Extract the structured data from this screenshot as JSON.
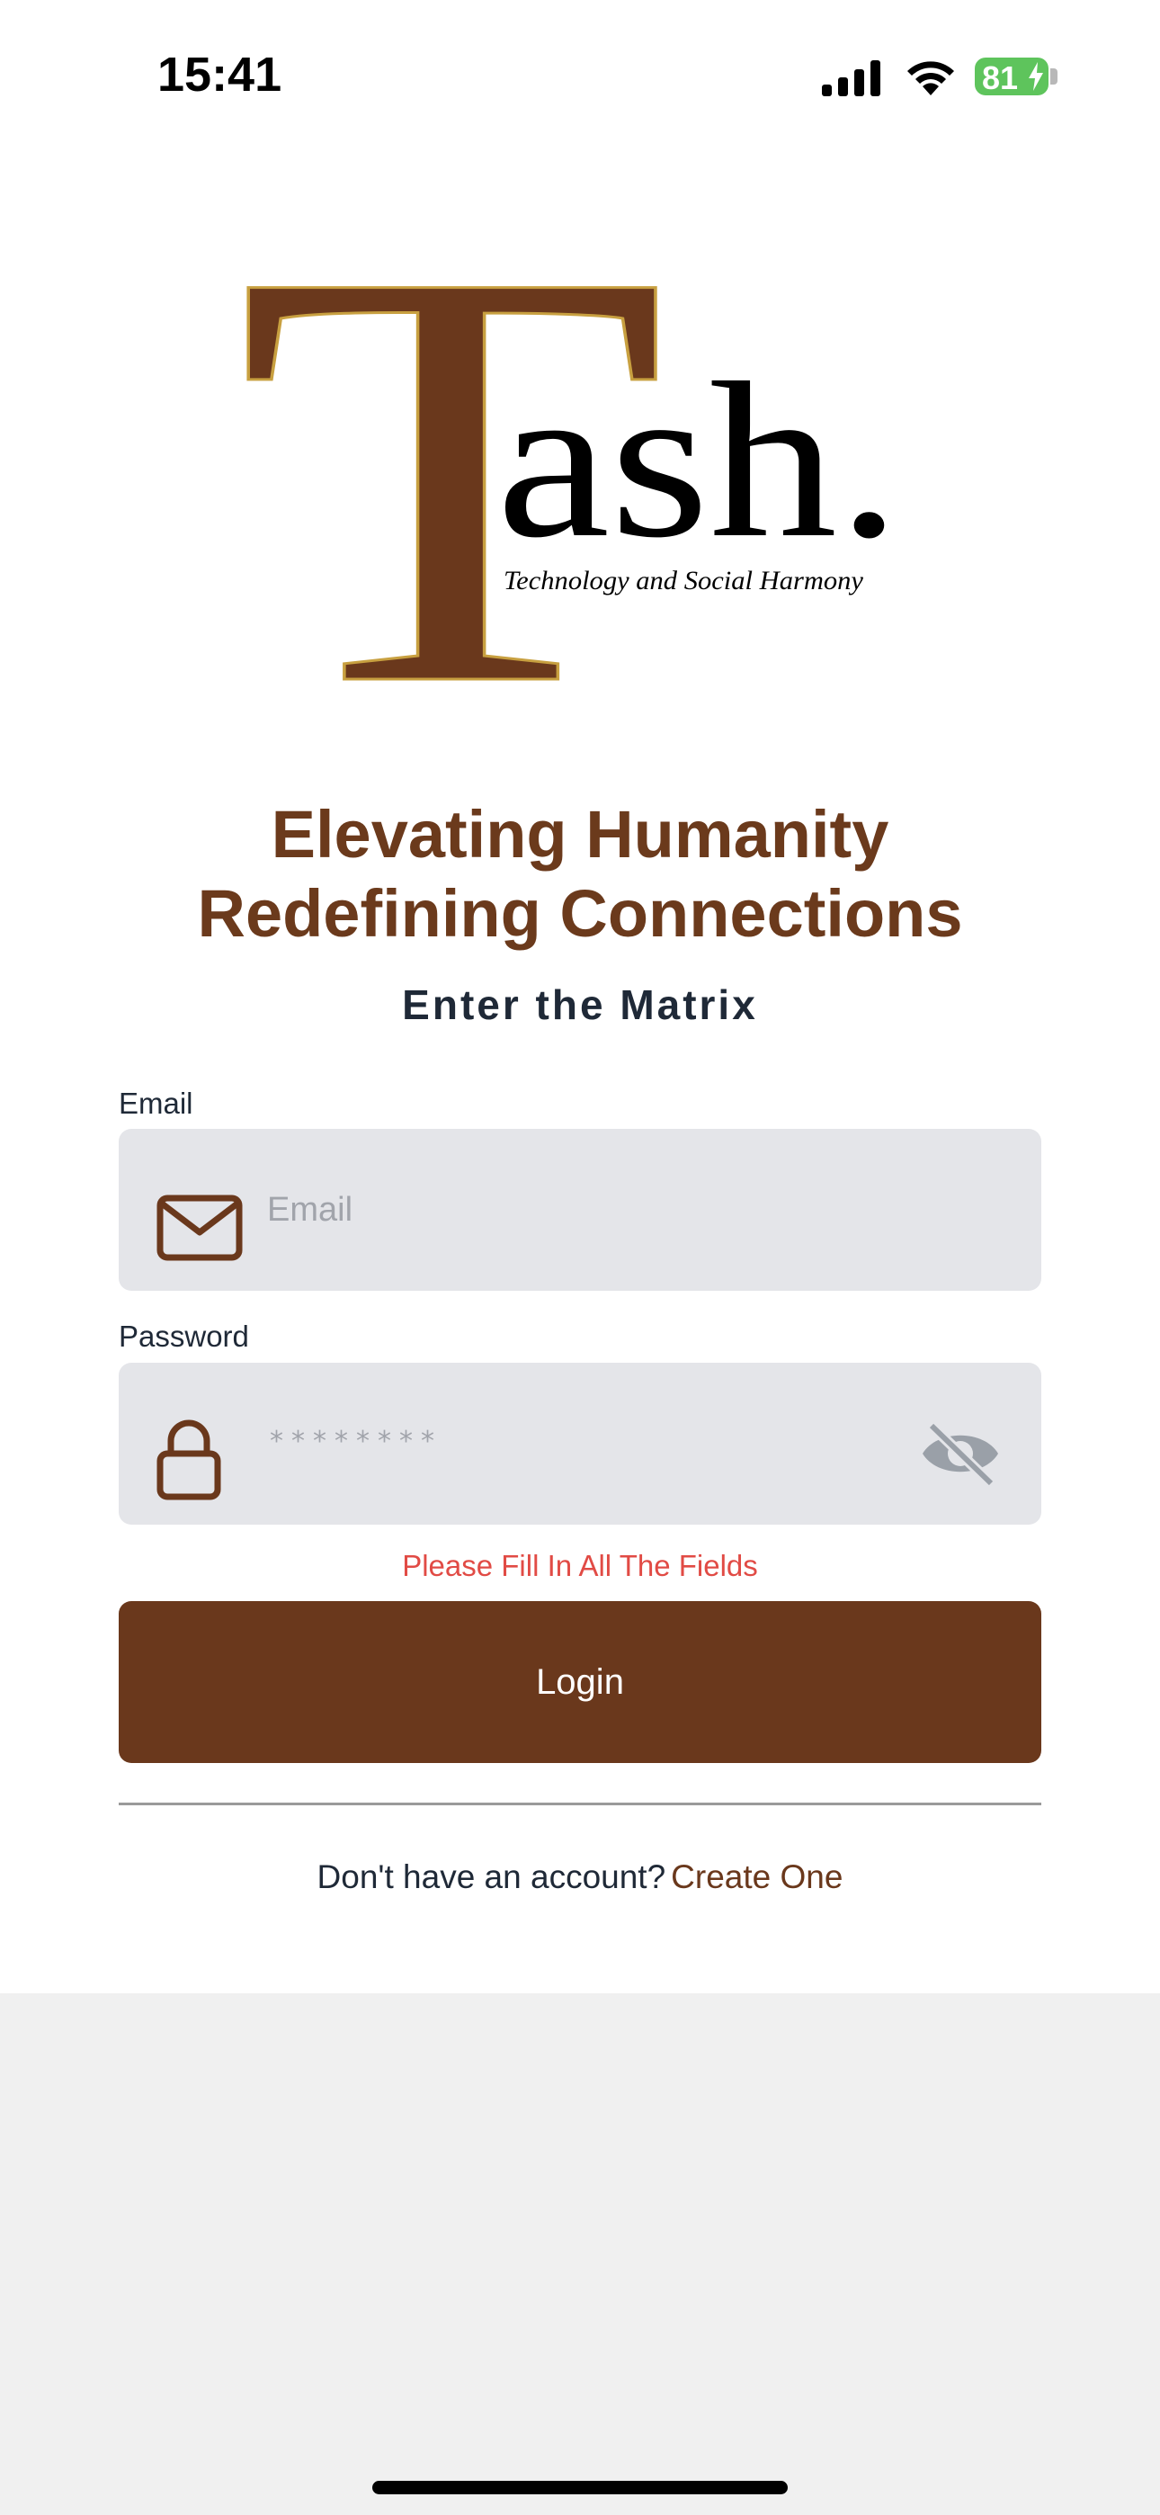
{
  "status_bar": {
    "time": "15:41",
    "battery": "81"
  },
  "logo": {
    "letter": "T",
    "wordmark": "ash.",
    "tagline": "Technology and Social Harmony"
  },
  "headline": {
    "line1": "Elevating Humanity",
    "line2": "Redefining Connections"
  },
  "subheadline": "Enter the Matrix",
  "email": {
    "label": "Email",
    "placeholder": "Email",
    "value": ""
  },
  "password": {
    "label": "Password",
    "masked_value": "********"
  },
  "error_message": "Please Fill In All The Fields",
  "login_label": "Login",
  "signup": {
    "prompt": "Don't have an account?",
    "link": "Create One"
  },
  "colors": {
    "brand": "#6a381c",
    "error": "#e14b45",
    "field_bg": "#e4e5e9"
  }
}
